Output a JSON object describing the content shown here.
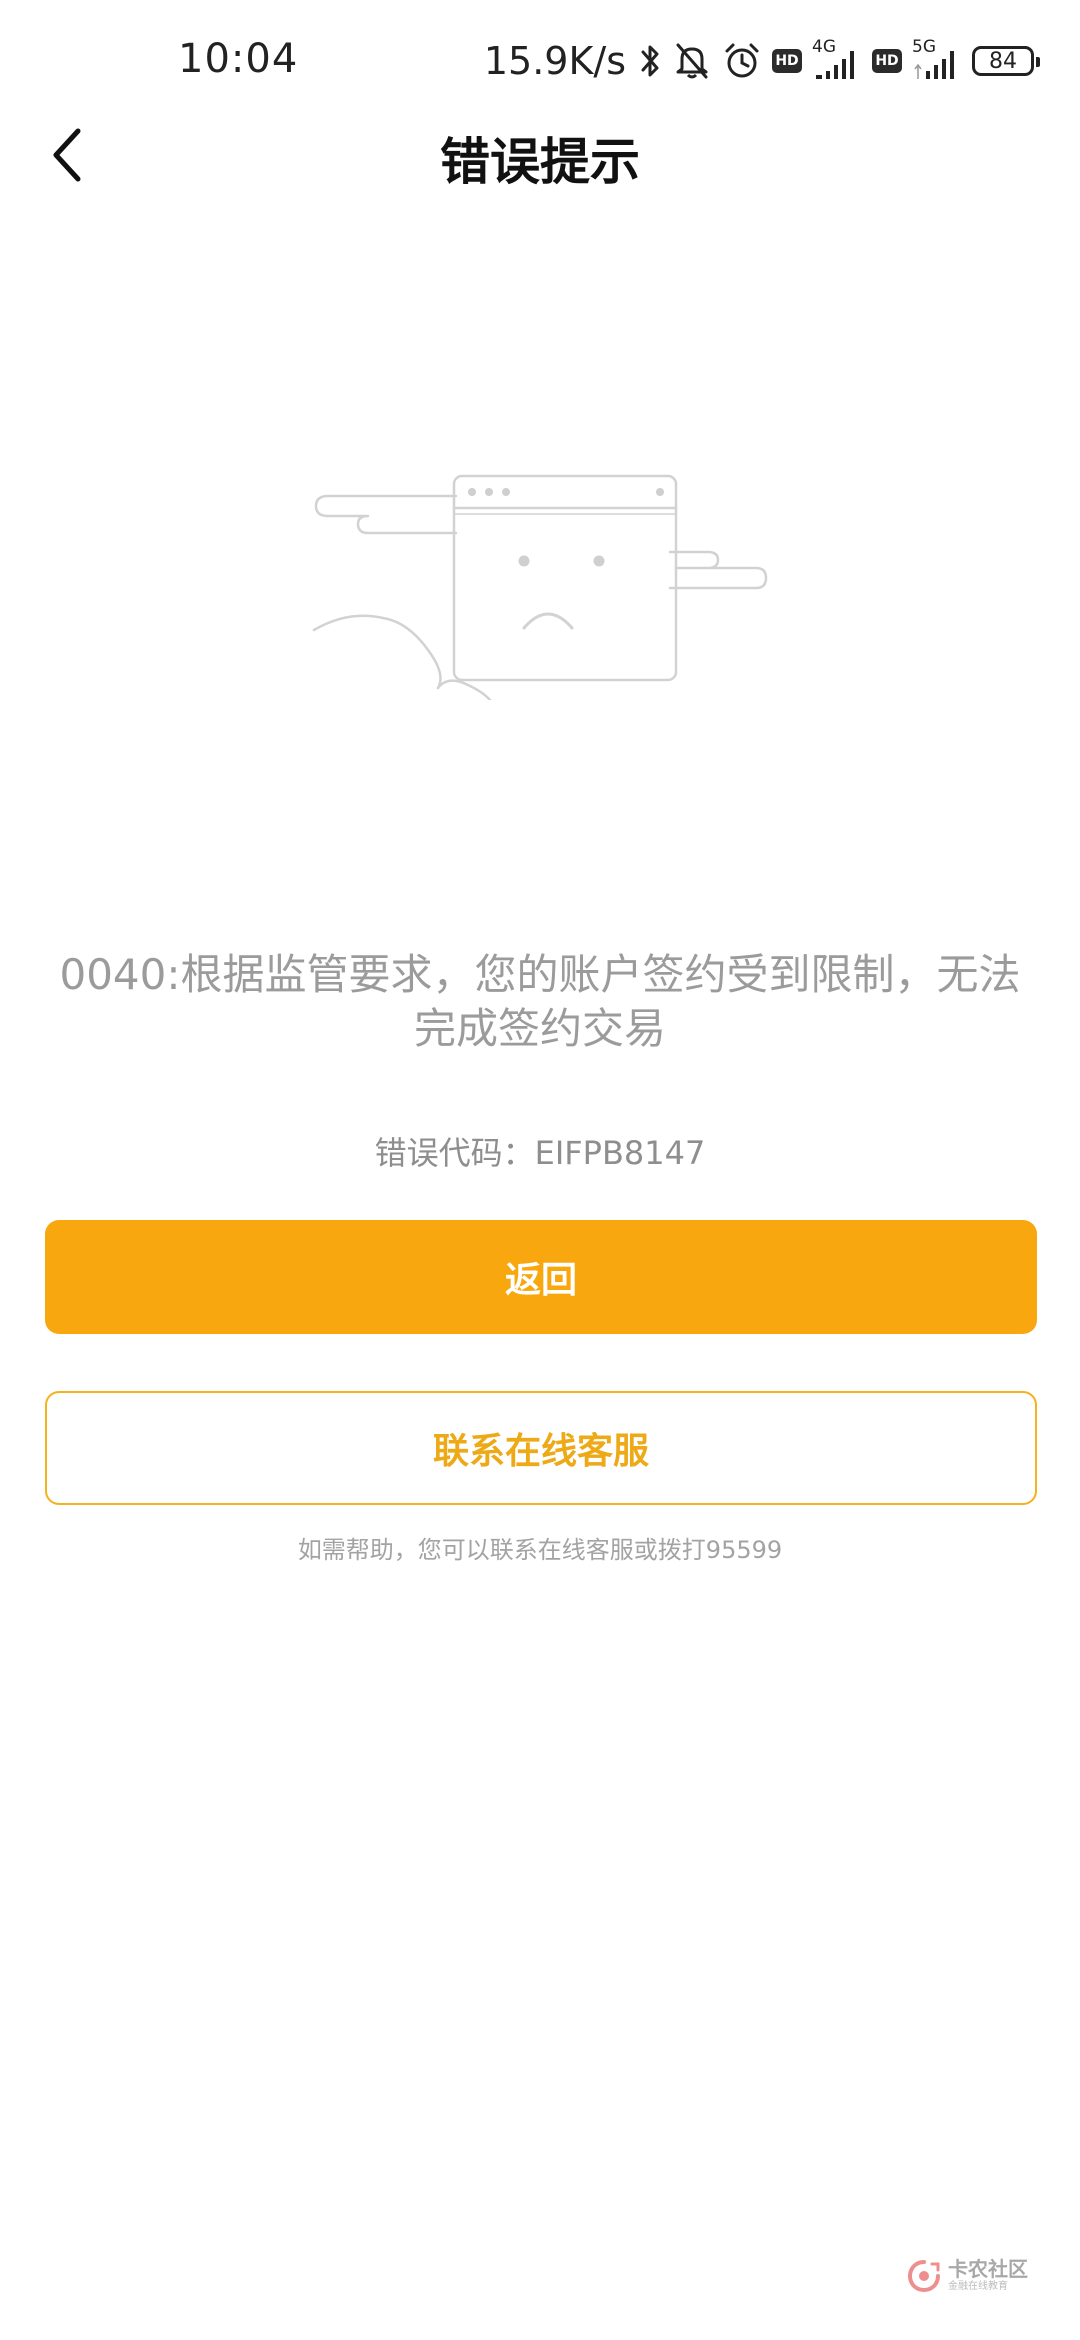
{
  "status_bar": {
    "time": "10:04",
    "net_speed": "15.9K/s",
    "network1": "4G",
    "network2": "5G",
    "hd_label": "HD",
    "battery": "84",
    "icons": [
      "bluetooth-icon",
      "mute-bell-icon",
      "alarm-icon",
      "signal-icon",
      "battery-icon"
    ]
  },
  "header": {
    "title": "错误提示",
    "back_icon": "chevron-left-icon"
  },
  "illustration": {
    "icon": "sad-browser-window-illustration"
  },
  "error": {
    "message_line1": "0040:根据监管要求，您的账户签约受到限制，无法",
    "message_line2": "完成签约交易",
    "code_label": "错误代码：EIFPB8147"
  },
  "actions": {
    "return_label": "返回",
    "contact_label": "联系在线客服"
  },
  "help": {
    "text": "如需帮助，您可以联系在线客服或拨打95599"
  },
  "watermark": {
    "title": "卡农社区",
    "subtitle": "金融在线教育"
  },
  "colors": {
    "primary": "#f8a80e",
    "outline": "#f2b31c",
    "message_gray": "#9b9b9b"
  }
}
